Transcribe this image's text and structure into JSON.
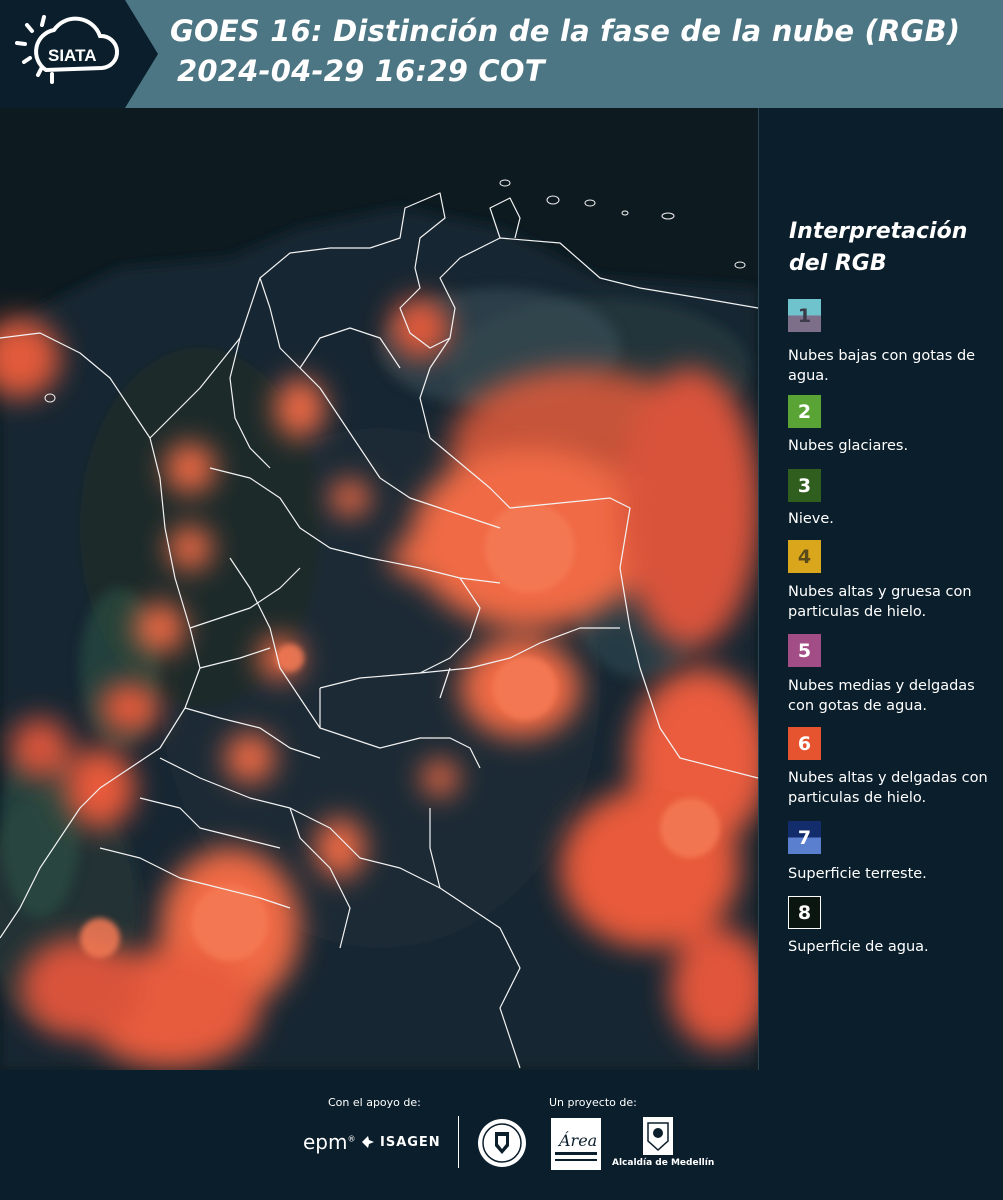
{
  "header": {
    "logo_text": "SIATA",
    "title_line1": "GOES 16: Distinción de la fase de la nube (RGB)",
    "title_line2": "2024-04-29 16:29 COT"
  },
  "legend": {
    "title_line1": "Interpretación",
    "title_line2": "del RGB",
    "items": [
      {
        "number": "1",
        "label": "Nubes bajas con gotas de agua.",
        "color_top": "#6ec3cd",
        "color_bottom": "#7d6e8a"
      },
      {
        "number": "2",
        "label": "Nubes glaciares.",
        "color": "#5aa335"
      },
      {
        "number": "3",
        "label": "Nieve.",
        "color": "#2f5e1f"
      },
      {
        "number": "4",
        "label": "Nubes altas y gruesa con particulas de hielo.",
        "color": "#d9a61c"
      },
      {
        "number": "5",
        "label": "Nubes medias y delgadas con gotas de agua.",
        "color": "#a24d86"
      },
      {
        "number": "6",
        "label": "Nubes altas y delgadas con particulas de hielo.",
        "color": "#e6542f"
      },
      {
        "number": "7",
        "label": "Superficie terreste.",
        "color_top": "#132c6b",
        "color_bottom": "#5b7fcf"
      },
      {
        "number": "8",
        "label": "Superficie de agua.",
        "color": "#0c1610"
      }
    ]
  },
  "footer": {
    "support_label": "Con el apoyo de:",
    "project_label": "Un proyecto de:",
    "epm_text": "epm",
    "isagen_text": "ISAGEN",
    "amva_text": "Área",
    "medellin_text": "Alcaldía de Medellín"
  }
}
